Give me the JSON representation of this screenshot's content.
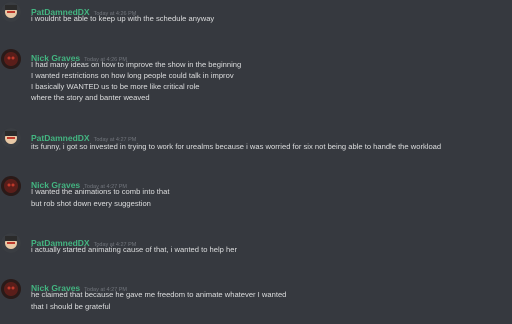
{
  "messages": [
    {
      "author": "PatDamnedDX",
      "author_color": "#43b581",
      "timestamp": "Today at 4:26 PM",
      "avatar": "patdamned-avatar",
      "lines": [
        "i wouldnt be able to keep up with the schedule anyway"
      ]
    },
    {
      "author": "Nick Graves",
      "author_color": "#43b581",
      "timestamp": "Today at 4:26 PM",
      "avatar": "nick-graves-avatar",
      "lines": [
        "I had many ideas on how to improve the show in the beginning",
        "I wanted restrictions on how long people could talk in improv",
        "I basically WANTED us to be more like critical role",
        "where the story and banter weaved"
      ]
    },
    {
      "author": "PatDamnedDX",
      "author_color": "#43b581",
      "timestamp": "Today at 4:27 PM",
      "avatar": "patdamned-avatar",
      "lines": [
        "its funny, i got so invested in trying to work for urealms because i was worried for six not being able to handle the workload"
      ]
    },
    {
      "author": "Nick Graves",
      "author_color": "#43b581",
      "timestamp": "Today at 4:27 PM",
      "avatar": "nick-graves-avatar",
      "lines": [
        "I wanted the animations to comb into that",
        "but rob shot down every suggestion"
      ]
    },
    {
      "author": "PatDamnedDX",
      "author_color": "#43b581",
      "timestamp": "Today at 4:27 PM",
      "avatar": "patdamned-avatar",
      "lines": [
        "i actually started animating cause of that, i wanted to help her"
      ]
    },
    {
      "author": "Nick Graves",
      "author_color": "#43b581",
      "timestamp": "Today at 4:27 PM",
      "avatar": "nick-graves-avatar",
      "lines": [
        "he claimed that because he gave me freedom to animate whatever I wanted",
        "that I should be grateful"
      ]
    }
  ]
}
